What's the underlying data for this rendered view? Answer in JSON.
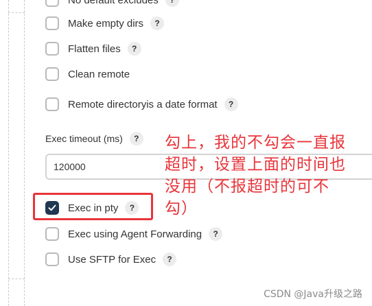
{
  "options": [
    {
      "id": "no-default-excludes",
      "label": "No default excludes",
      "checked": false
    },
    {
      "id": "make-empty-dirs",
      "label": "Make empty dirs",
      "checked": false
    },
    {
      "id": "flatten-files",
      "label": "Flatten files",
      "checked": false
    },
    {
      "id": "clean-remote",
      "label": "Clean remote",
      "checked": false
    },
    {
      "id": "remote-directory-date",
      "label": "Remote directoryis a date format",
      "checked": false
    }
  ],
  "exec_timeout": {
    "label": "Exec timeout (ms)",
    "value": "120000"
  },
  "exec_options": [
    {
      "id": "exec-in-pty",
      "label": "Exec in pty",
      "checked": true
    },
    {
      "id": "agent-forwarding",
      "label": "Exec using Agent Forwarding",
      "checked": false
    },
    {
      "id": "sftp-exec",
      "label": "Use SFTP for Exec",
      "checked": false
    }
  ],
  "help_symbol": "?",
  "check_icon": "check-icon",
  "annotation": {
    "lines": [
      "勾上，我的不勾会一直报",
      "超时，设置上面的时间也",
      "没用（不报超时的可不",
      "勾）"
    ],
    "color": "#e8343a"
  },
  "watermark": "CSDN @Java升级之路",
  "colors": {
    "checked": "#1f3953",
    "annotation": "#e8343a"
  }
}
